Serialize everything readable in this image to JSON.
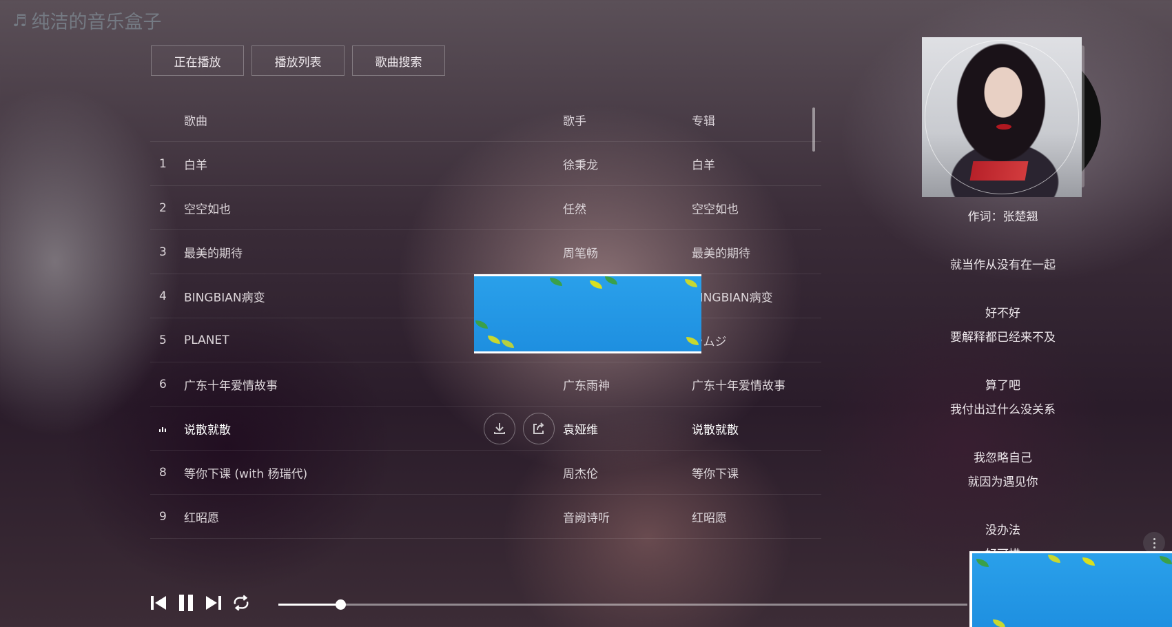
{
  "app": {
    "title": "纯洁的音乐盒子",
    "note_icon": "music-note-icon"
  },
  "tabs": [
    {
      "label": "正在播放"
    },
    {
      "label": "播放列表"
    },
    {
      "label": "歌曲搜索"
    }
  ],
  "table": {
    "headers": {
      "song": "歌曲",
      "artist": "歌手",
      "album": "专辑"
    },
    "rows": [
      {
        "num": "1",
        "song": "白羊",
        "artist": "徐秉龙",
        "album": "白羊"
      },
      {
        "num": "2",
        "song": "空空如也",
        "artist": "任然",
        "album": "空空如也"
      },
      {
        "num": "3",
        "song": "最美的期待",
        "artist": "周笔畅",
        "album": "最美的期待"
      },
      {
        "num": "4",
        "song": "BINGBIAN病变",
        "artist": "",
        "album": "BINGBIAN病变"
      },
      {
        "num": "5",
        "song": "PLANET",
        "artist": "",
        "album": "ラムジ"
      },
      {
        "num": "6",
        "song": "广东十年爱情故事",
        "artist": "广东雨神",
        "album": "广东十年爱情故事"
      },
      {
        "num": "",
        "song": "说散就散",
        "artist": "袁娅维",
        "album": "说散就散",
        "playing": true
      },
      {
        "num": "8",
        "song": "等你下课 (with 杨瑞代)",
        "artist": "周杰伦",
        "album": "等你下课"
      },
      {
        "num": "9",
        "song": "红昭愿",
        "artist": "音阙诗听",
        "album": "红昭愿"
      }
    ]
  },
  "row_actions": {
    "download_icon": "download-icon",
    "share_icon": "share-icon"
  },
  "lyrics": [
    "作词：张楚翘",
    "",
    "就当作从没有在一起",
    "",
    "好不好",
    "要解释都已经来不及",
    "",
    "算了吧",
    "我付出过什么没关系",
    "",
    "我忽略自己",
    "就因为遇见你",
    "",
    "没办法",
    "好可惜"
  ],
  "player": {
    "progress": 0.09,
    "icons": [
      "previous-icon",
      "pause-icon",
      "next-icon",
      "repeat-icon"
    ]
  },
  "colors": {
    "ad_blue": "#1e8fe0",
    "accent_white": "#ffffff"
  }
}
